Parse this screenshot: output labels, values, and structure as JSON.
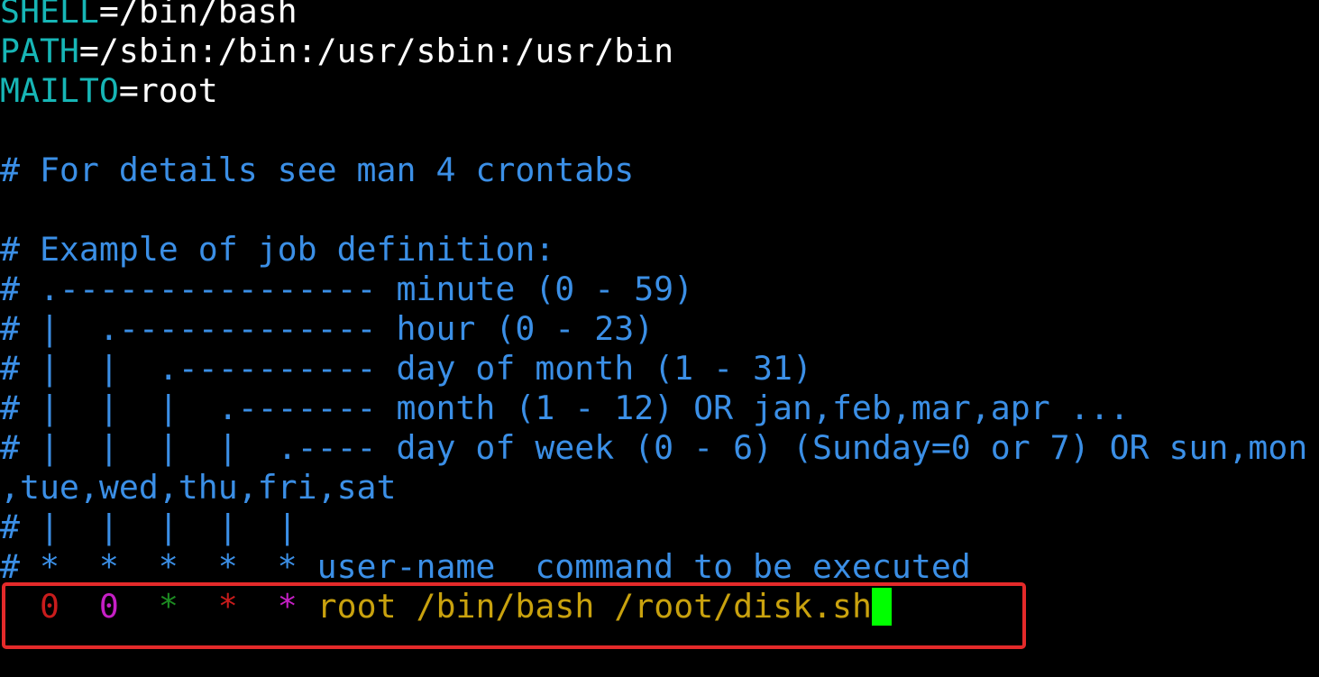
{
  "palette": {
    "cyan": "#17b6b6",
    "white": "#ffffff",
    "blue": "#3b8fe6",
    "red": "#c91c1c",
    "magenta": "#c51fc5",
    "green": "#1d8c22",
    "yellow": "#c9a20e",
    "cursor": "#00ff00",
    "annotation": "#e42a2a"
  },
  "terminal": {
    "lines": [
      {
        "segments": [
          {
            "text": "SHELL",
            "color": "cyan"
          },
          {
            "text": "=/bin/bash",
            "color": "white"
          }
        ]
      },
      {
        "segments": [
          {
            "text": "PATH",
            "color": "cyan"
          },
          {
            "text": "=/sbin:/bin:/usr/sbin:/usr/bin",
            "color": "white"
          }
        ]
      },
      {
        "segments": [
          {
            "text": "MAILTO",
            "color": "cyan"
          },
          {
            "text": "=root",
            "color": "white"
          }
        ]
      },
      {
        "segments": []
      },
      {
        "segments": [
          {
            "text": "# For details see man 4 crontabs",
            "color": "blue"
          }
        ]
      },
      {
        "segments": []
      },
      {
        "segments": [
          {
            "text": "# Example of job definition:",
            "color": "blue"
          }
        ]
      },
      {
        "segments": [
          {
            "text": "# .---------------- minute (0 - 59)",
            "color": "blue"
          }
        ]
      },
      {
        "segments": [
          {
            "text": "# |  .------------- hour (0 - 23)",
            "color": "blue"
          }
        ]
      },
      {
        "segments": [
          {
            "text": "# |  |  .---------- day of month (1 - 31)",
            "color": "blue"
          }
        ]
      },
      {
        "segments": [
          {
            "text": "# |  |  |  .------- month (1 - 12) OR jan,feb,mar,apr ...",
            "color": "blue"
          }
        ]
      },
      {
        "segments": [
          {
            "text": "# |  |  |  |  .---- day of week (0 - 6) (Sunday=0 or 7) OR sun,mon",
            "color": "blue"
          }
        ]
      },
      {
        "segments": [
          {
            "text": ",tue,wed,thu,fri,sat",
            "color": "blue"
          }
        ]
      },
      {
        "segments": [
          {
            "text": "# |  |  |  |  |",
            "color": "blue"
          }
        ]
      },
      {
        "segments": [
          {
            "text": "# *  *  *  *  * user-name  command to be executed",
            "color": "blue"
          }
        ]
      },
      {
        "segments": [
          {
            "text": "  ",
            "color": "white"
          },
          {
            "text": "0",
            "color": "red"
          },
          {
            "text": "  ",
            "color": "white"
          },
          {
            "text": "0",
            "color": "magenta"
          },
          {
            "text": "  ",
            "color": "white"
          },
          {
            "text": "*",
            "color": "green"
          },
          {
            "text": "  ",
            "color": "white"
          },
          {
            "text": "*",
            "color": "red"
          },
          {
            "text": "  ",
            "color": "white"
          },
          {
            "text": "*",
            "color": "magenta"
          },
          {
            "text": " ",
            "color": "white"
          },
          {
            "text": "root /bin/bash /root/disk.sh",
            "color": "yellow"
          }
        ]
      }
    ]
  }
}
